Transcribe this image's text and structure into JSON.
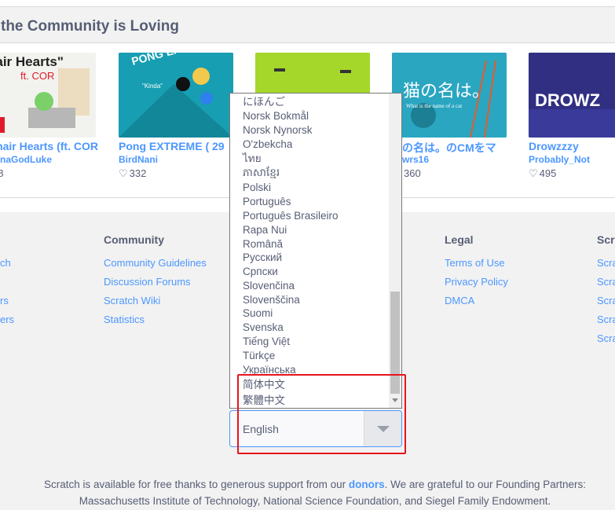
{
  "section": {
    "title": "the Community is Loving"
  },
  "projects": [
    {
      "title": "hair Hearts (ft. COR",
      "author": "naGodLuke",
      "loves": "48",
      "thumb_text": "hair Hearts\"",
      "thumb_sub": "ft. COR",
      "thumb_badge": "vo"
    },
    {
      "title": "Pong EXTREME ( 29",
      "author": "BirdNani",
      "loves": "332",
      "thumb_text": "PONG EXTREME",
      "thumb_sub": "\"Kinda\""
    },
    {
      "title": "",
      "author": "",
      "loves": ""
    },
    {
      "title": "の名は。のCMをマ",
      "author": "wrs16",
      "loves": "360",
      "thumb_text": "猫の名は。",
      "thumb_sub": "What is the name of a cat"
    },
    {
      "title": "Drowzzzy",
      "author": "Probably_Not",
      "loves": "495",
      "thumb_text": "DROWZ"
    }
  ],
  "footer": {
    "col_left_links": [
      "ch",
      "rs",
      "ers"
    ],
    "community": {
      "title": "Community",
      "links": [
        "Community Guidelines",
        "Discussion Forums",
        "Scratch Wiki",
        "Statistics"
      ]
    },
    "legal": {
      "title": "Legal",
      "links": [
        "Terms of Use",
        "Privacy Policy",
        "DMCA"
      ]
    },
    "scratch_col": {
      "title": "Scra",
      "links": [
        "Scra",
        "Scra",
        "Scra",
        "Scra",
        "Scra"
      ]
    },
    "donors_prefix": "Scratch is available for free thanks to generous support from our ",
    "donors_link": "donors",
    "donors_suffix": ". We are grateful to our Founding Partners:",
    "partners": "Massachusetts Institute of Technology, National Science Foundation, and Siegel Family Endowment."
  },
  "language": {
    "selected": "English",
    "options": [
      "にほんご",
      "Norsk Bokmål",
      "Norsk Nynorsk",
      "O'zbekcha",
      "ไทย",
      "ភាសាខ្មែរ",
      "Polski",
      "Português",
      "Português Brasileiro",
      "Rapa Nui",
      "Română",
      "Русский",
      "Српски",
      "Slovenčina",
      "Slovenščina",
      "Suomi",
      "Svenska",
      "Tiếng Việt",
      "Türkçe",
      "Українська",
      "简体中文",
      "繁體中文"
    ]
  },
  "colors": {
    "link": "#4c97ff",
    "text": "#575e75",
    "highlight": "#e8141c"
  }
}
